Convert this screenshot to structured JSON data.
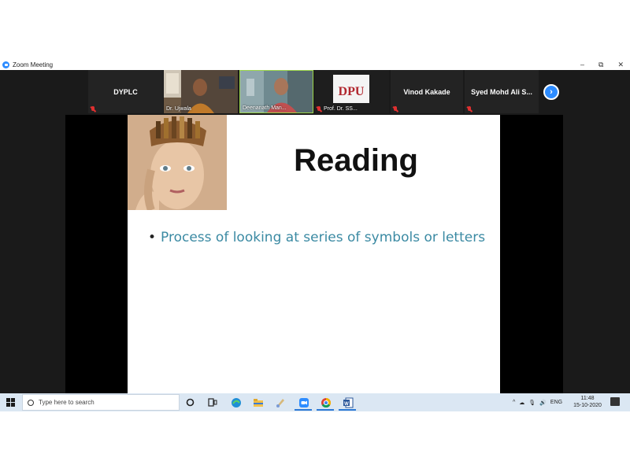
{
  "window": {
    "title": "Zoom Meeting",
    "minimize": "–",
    "restore": "⧉",
    "close": "✕"
  },
  "participants": [
    {
      "name": "DYPLC",
      "type": "name-tile"
    },
    {
      "name": "Dr. Ujwala",
      "type": "video"
    },
    {
      "name": "Deenanath Man...",
      "type": "video"
    },
    {
      "name": "Prof. Dr. SS...",
      "type": "video",
      "logo_text": "DPU"
    },
    {
      "name": "Vinod Kakade",
      "type": "name-tile"
    },
    {
      "name": "Syed Mohd Ali S...",
      "type": "name-tile"
    }
  ],
  "next_button": "›",
  "slide": {
    "title": "Reading",
    "bullet": "Process of looking at series of symbols or letters"
  },
  "taskbar": {
    "search_placeholder": "Type here to search",
    "tray": {
      "chevron": "^",
      "language": "ENG",
      "time": "11:48",
      "date": "15-10-2020"
    }
  },
  "colors": {
    "zoom_blue": "#2d8cff",
    "bullet_text": "#3b8aa3",
    "strip_bg": "#1a1a1a",
    "taskbar_bg": "#dbe7f3"
  }
}
